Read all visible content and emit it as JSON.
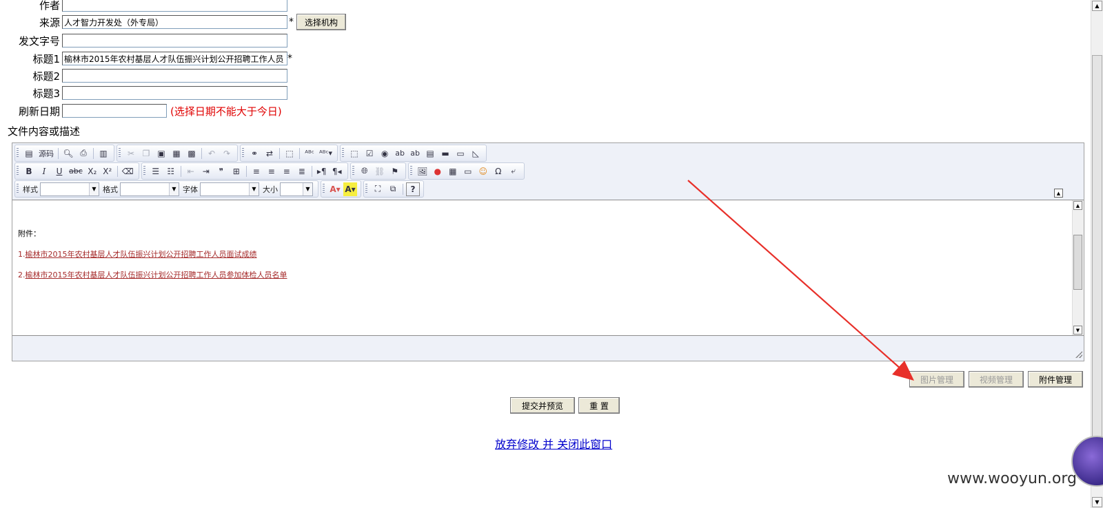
{
  "form": {
    "author": {
      "label": "作者",
      "value": ""
    },
    "source": {
      "label": "来源",
      "value": "人才智力开发处（外专局）",
      "required": "*",
      "button": "选择机构"
    },
    "doc_no": {
      "label": "发文字号",
      "value": ""
    },
    "title1": {
      "label": "标题1",
      "value": "榆林市2015年农村基层人才队伍振兴计划公开招聘工作人员",
      "required": "*"
    },
    "title2": {
      "label": "标题2",
      "value": ""
    },
    "title3": {
      "label": "标题3",
      "value": ""
    },
    "refresh_date": {
      "label": "刷新日期",
      "value": "",
      "note": "(选择日期不能大于今日)"
    },
    "content_label": "文件内容或描述"
  },
  "editor": {
    "toolbar": {
      "source_label": "源码",
      "style_label": "样式",
      "format_label": "格式",
      "font_label": "字体",
      "size_label": "大小",
      "bold": "B",
      "italic": "I",
      "underline": "U",
      "strike": "abc",
      "subscript": "X₂",
      "superscript": "X²",
      "omega": "Ω",
      "help": "?"
    },
    "content": {
      "attachments_heading": "附件：",
      "items": [
        {
          "prefix": "1.",
          "text": "榆林市2015年农村基层人才队伍振兴计划公开招聘工作人员面试成绩"
        },
        {
          "prefix": "2.",
          "text": "榆林市2015年农村基层人才队伍振兴计划公开招聘工作人员参加体检人员名单"
        }
      ]
    }
  },
  "media_buttons": {
    "image": "图片管理",
    "video": "视频管理",
    "attachment": "附件管理"
  },
  "actions": {
    "submit": "提交并预览",
    "reset": "重 置",
    "discard": "放弃修改 并 关闭此窗口"
  },
  "watermark": "www.wooyun.org",
  "colors": {
    "note_red": "#e00000",
    "link_blue": "#0000cc",
    "attachment_link": "#a52a2a",
    "annotation_arrow": "#e8302a"
  }
}
